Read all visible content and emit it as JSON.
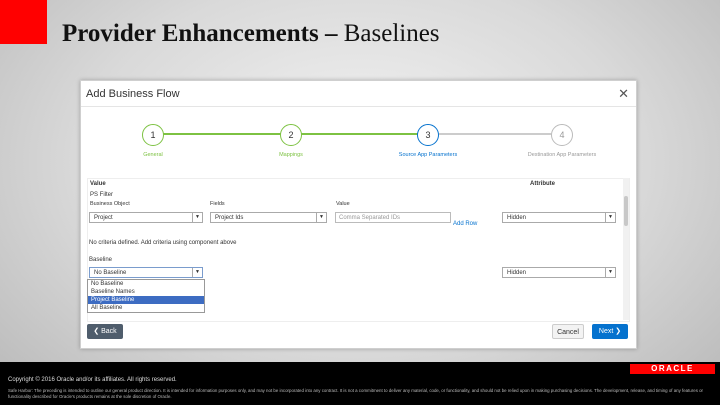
{
  "slide": {
    "title_bold": "Provider Enhancements –",
    "title_rest": " Baselines",
    "copyright": "Copyright © 2016 Oracle and/or its affiliates. All rights reserved.",
    "safe_harbor": "Safe Harbor: The preceding is intended to outline our general product direction. It is intended for information purposes only, and may not be incorporated into any contract. It is not a commitment to deliver any material, code, or functionality, and should not be relied upon in making purchasing decisions. The development, release, and timing of any features or functionality described for Oracle's products remains at the sole discretion of Oracle.",
    "logo_text": "ORACLE"
  },
  "dialog": {
    "title": "Add Business Flow",
    "close_glyph": "✕",
    "steps": [
      {
        "num": "1",
        "label": "General"
      },
      {
        "num": "2",
        "label": "Mappings"
      },
      {
        "num": "3",
        "label": "Source App Parameters"
      },
      {
        "num": "4",
        "label": "Destination App Parameters"
      }
    ],
    "grid": {
      "value_header": "Value",
      "attribute_header": "Attribute",
      "ps_filter_label": "PS Filter",
      "business_object_label": "Business Object",
      "fields_label": "Fields",
      "value_label": "Value",
      "business_object_value": "Project",
      "fields_value": "Project Ids",
      "value_placeholder": "Comma Separated IDs",
      "add_row": "Add Row",
      "attr_row1": "Hidden",
      "no_criteria": "No criteria defined. Add criteria using component above",
      "baseline_label": "Baseline",
      "baseline_value": "No Baseline",
      "attr_row2": "Hidden",
      "baseline_options": [
        "No Baseline",
        "Baseline Names",
        "Project Baseline",
        "All Baseline"
      ],
      "dropdown_arrow": "▼"
    },
    "buttons": {
      "back": "❮ Back",
      "cancel": "Cancel",
      "next": "Next ❯"
    }
  }
}
